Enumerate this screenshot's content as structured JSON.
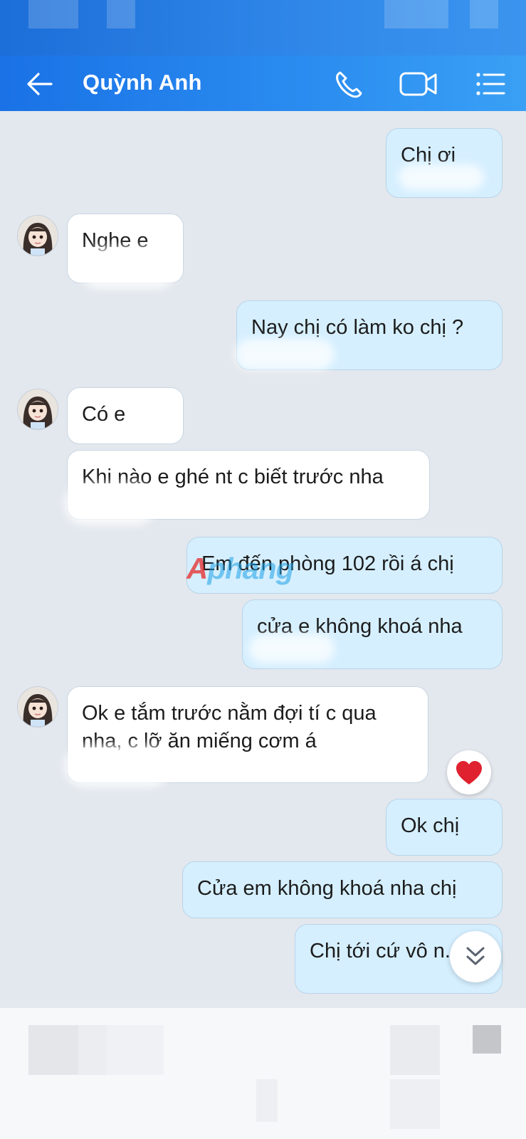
{
  "header": {
    "title": "Quỳnh Anh",
    "back_icon": "arrow-left-icon",
    "call_icon": "phone-icon",
    "video_icon": "video-camera-icon",
    "menu_icon": "list-menu-icon"
  },
  "messages": [
    {
      "from": "me",
      "text": "Chị ơi"
    },
    {
      "from": "contact",
      "text": "Nghe e"
    },
    {
      "from": "me",
      "text": "Nay chị có làm ko chị ?"
    },
    {
      "from": "contact",
      "text": "Có e"
    },
    {
      "from": "contact",
      "text": "Khi nào e ghé nt c biết trước nha"
    },
    {
      "from": "me",
      "text": "Em đến phòng 102 rồi á chị"
    },
    {
      "from": "me",
      "text": "cửa e không khoá nha"
    },
    {
      "from": "contact",
      "text": "Ok e tắm trước nằm đợi tí c qua nha, c lỡ ăn miếng cơm á"
    },
    {
      "from": "me",
      "text": "Ok chị"
    },
    {
      "from": "me",
      "text": "Cửa em không khoá nha chị"
    },
    {
      "from": "me",
      "text": "Chị tới cứ vô n..."
    }
  ],
  "reaction": {
    "icon": "heart-icon",
    "color": "#e0212f"
  },
  "scroll_down_icon": "double-chevron-down-icon",
  "watermark": {
    "prefix": "A",
    "rest": "phang"
  },
  "colors": {
    "header": "#2b8df0",
    "outgoing_bubble": "#d5efff",
    "incoming_bubble": "#ffffff",
    "background": "#e3e8ee"
  }
}
